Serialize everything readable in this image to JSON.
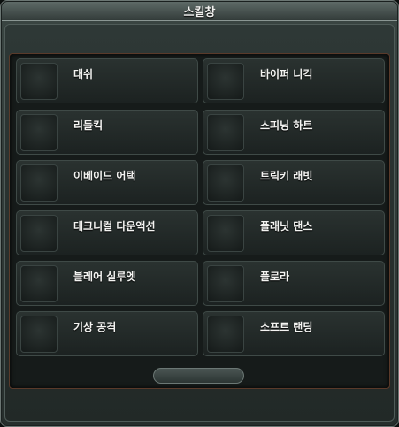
{
  "window": {
    "title": "스킬창"
  },
  "skills": {
    "left": [
      {
        "label": "대쉬"
      },
      {
        "label": "리들킥"
      },
      {
        "label": "이베이드 어택"
      },
      {
        "label": "테크니컬 다운액션"
      },
      {
        "label": "블레어 실루엣"
      },
      {
        "label": "기상 공격"
      }
    ],
    "right": [
      {
        "label": "바이퍼 니킥"
      },
      {
        "label": "스피닝 하트"
      },
      {
        "label": "트릭키 래빗"
      },
      {
        "label": "플래닛 댄스"
      },
      {
        "label": "플로라"
      },
      {
        "label": "소프트 랜딩"
      }
    ]
  }
}
